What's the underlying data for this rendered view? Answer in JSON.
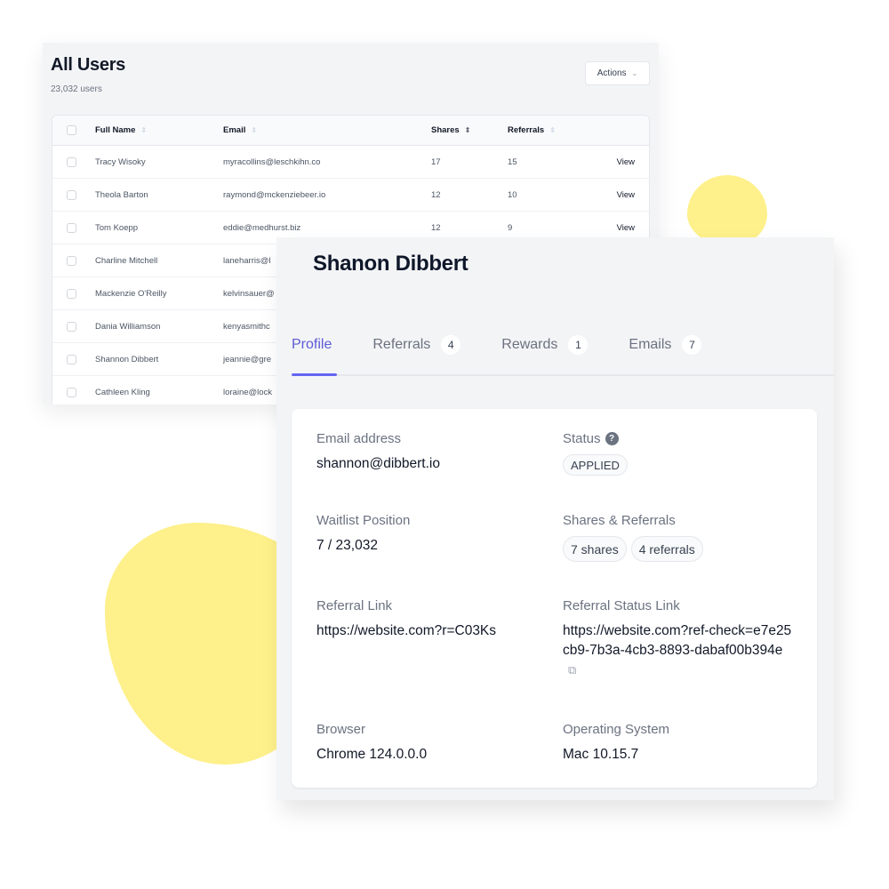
{
  "users_panel": {
    "title": "All Users",
    "count": "23,032 users",
    "actions_label": "Actions",
    "columns": {
      "full_name": "Full Name",
      "email": "Email",
      "shares": "Shares",
      "referrals": "Referrals"
    },
    "rows": [
      {
        "name": "Tracy Wisoky",
        "email": "myracollins@leschkihn.co",
        "shares": "17",
        "referrals": "15",
        "action": "View"
      },
      {
        "name": "Theola Barton",
        "email": "raymond@mckenziebeer.io",
        "shares": "12",
        "referrals": "10",
        "action": "View"
      },
      {
        "name": "Tom Koepp",
        "email": "eddie@medhurst.biz",
        "shares": "12",
        "referrals": "9",
        "action": "View"
      },
      {
        "name": "Charline Mitchell",
        "email": "laneharris@l",
        "shares": "",
        "referrals": "",
        "action": ""
      },
      {
        "name": "Mackenzie O'Reilly",
        "email": "kelvinsauer@",
        "shares": "",
        "referrals": "",
        "action": ""
      },
      {
        "name": "Dania Williamson",
        "email": "kenyasmithc",
        "shares": "",
        "referrals": "",
        "action": ""
      },
      {
        "name": "Shannon Dibbert",
        "email": "jeannie@gre",
        "shares": "",
        "referrals": "",
        "action": ""
      },
      {
        "name": "Cathleen Kling",
        "email": "loraine@lock",
        "shares": "",
        "referrals": "",
        "action": ""
      }
    ]
  },
  "profile": {
    "name": "Shanon Dibbert",
    "tabs": [
      {
        "label": "Profile",
        "badge": null,
        "active": true
      },
      {
        "label": "Referrals",
        "badge": "4",
        "active": false
      },
      {
        "label": "Rewards",
        "badge": "1",
        "active": false
      },
      {
        "label": "Emails",
        "badge": "7",
        "active": false
      }
    ],
    "fields": {
      "email_label": "Email address",
      "email_value": "shannon@dibbert.io",
      "status_label": "Status",
      "status_value": "APPLIED",
      "waitlist_label": "Waitlist Position",
      "waitlist_value": "7 / 23,032",
      "shares_label": "Shares & Referrals",
      "shares_value": "7 shares",
      "referrals_value": "4 referrals",
      "referral_link_label": "Referral Link",
      "referral_link_value": "https://website.com?r=C03Ks",
      "status_link_label": "Referral Status Link",
      "status_link_value": "https://website.com?ref-check=e7e25cb9-7b3a-4cb3-8893-dabaf00b394e",
      "browser_label": "Browser",
      "browser_value": "Chrome 124.0.0.0",
      "os_label": "Operating System",
      "os_value": "Mac 10.15.7"
    },
    "icons": {
      "help": "?",
      "external": "⧉"
    }
  },
  "colors": {
    "accent": "#6366f1",
    "blob": "#fef08a",
    "panel_bg": "#f3f4f6"
  }
}
